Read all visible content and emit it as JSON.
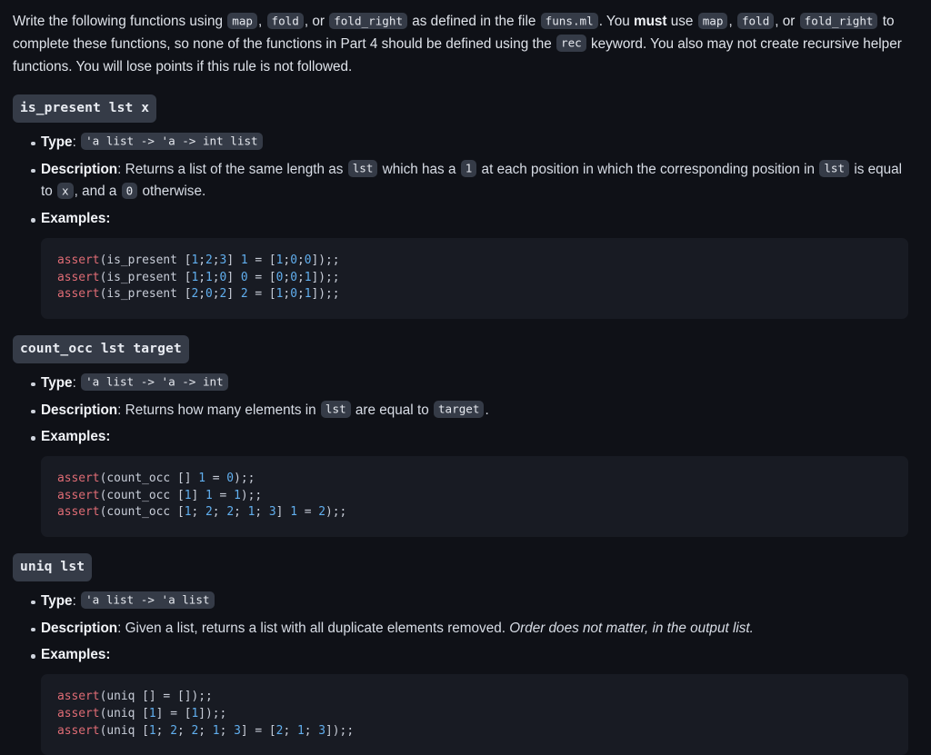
{
  "intro": {
    "segments": [
      {
        "t": "text",
        "v": "Write the following functions using "
      },
      {
        "t": "code",
        "v": "map"
      },
      {
        "t": "text",
        "v": ", "
      },
      {
        "t": "code",
        "v": "fold"
      },
      {
        "t": "text",
        "v": ", or "
      },
      {
        "t": "code",
        "v": "fold_right"
      },
      {
        "t": "text",
        "v": " as defined in the file "
      },
      {
        "t": "code",
        "v": "funs.ml"
      },
      {
        "t": "text",
        "v": ". You "
      },
      {
        "t": "bold",
        "v": "must"
      },
      {
        "t": "text",
        "v": " use "
      },
      {
        "t": "code",
        "v": "map"
      },
      {
        "t": "text",
        "v": ", "
      },
      {
        "t": "code",
        "v": "fold"
      },
      {
        "t": "text",
        "v": ", or "
      },
      {
        "t": "code",
        "v": "fold_right"
      },
      {
        "t": "text",
        "v": " to complete these functions, so none of the functions in Part 4 should be defined using the "
      },
      {
        "t": "code",
        "v": "rec"
      },
      {
        "t": "text",
        "v": " keyword. You also may not create recursive helper functions. You will lose points if this rule is not followed."
      }
    ]
  },
  "labels": {
    "type": "Type",
    "description": "Description",
    "examples": "Examples:"
  },
  "sections": [
    {
      "signature": "is_present lst x",
      "type": "'a list -> 'a -> int list",
      "description": [
        {
          "t": "lbl",
          "v": "Description"
        },
        {
          "t": "text",
          "v": ": Returns a list of the same length as "
        },
        {
          "t": "code",
          "v": "lst"
        },
        {
          "t": "text",
          "v": " which has a "
        },
        {
          "t": "code",
          "v": "1"
        },
        {
          "t": "text",
          "v": " at each position in which the corresponding position in "
        },
        {
          "t": "code",
          "v": "lst"
        },
        {
          "t": "text",
          "v": " is equal to "
        },
        {
          "t": "code",
          "v": "x"
        },
        {
          "t": "text",
          "v": ", and a "
        },
        {
          "t": "code",
          "v": "0"
        },
        {
          "t": "text",
          "v": " otherwise."
        }
      ],
      "code": [
        [
          {
            "c": "fn",
            "v": "assert"
          },
          {
            "c": "pl",
            "v": "(is_present ["
          },
          {
            "c": "num",
            "v": "1"
          },
          {
            "c": "pl",
            "v": ";"
          },
          {
            "c": "num",
            "v": "2"
          },
          {
            "c": "pl",
            "v": ";"
          },
          {
            "c": "num",
            "v": "3"
          },
          {
            "c": "pl",
            "v": "] "
          },
          {
            "c": "num",
            "v": "1"
          },
          {
            "c": "pl",
            "v": " = ["
          },
          {
            "c": "num",
            "v": "1"
          },
          {
            "c": "pl",
            "v": ";"
          },
          {
            "c": "num",
            "v": "0"
          },
          {
            "c": "pl",
            "v": ";"
          },
          {
            "c": "num",
            "v": "0"
          },
          {
            "c": "pl",
            "v": "]);;"
          }
        ],
        [
          {
            "c": "fn",
            "v": "assert"
          },
          {
            "c": "pl",
            "v": "(is_present ["
          },
          {
            "c": "num",
            "v": "1"
          },
          {
            "c": "pl",
            "v": ";"
          },
          {
            "c": "num",
            "v": "1"
          },
          {
            "c": "pl",
            "v": ";"
          },
          {
            "c": "num",
            "v": "0"
          },
          {
            "c": "pl",
            "v": "] "
          },
          {
            "c": "num",
            "v": "0"
          },
          {
            "c": "pl",
            "v": " = ["
          },
          {
            "c": "num",
            "v": "0"
          },
          {
            "c": "pl",
            "v": ";"
          },
          {
            "c": "num",
            "v": "0"
          },
          {
            "c": "pl",
            "v": ";"
          },
          {
            "c": "num",
            "v": "1"
          },
          {
            "c": "pl",
            "v": "]);;"
          }
        ],
        [
          {
            "c": "fn",
            "v": "assert"
          },
          {
            "c": "pl",
            "v": "(is_present ["
          },
          {
            "c": "num",
            "v": "2"
          },
          {
            "c": "pl",
            "v": ";"
          },
          {
            "c": "num",
            "v": "0"
          },
          {
            "c": "pl",
            "v": ";"
          },
          {
            "c": "num",
            "v": "2"
          },
          {
            "c": "pl",
            "v": "] "
          },
          {
            "c": "num",
            "v": "2"
          },
          {
            "c": "pl",
            "v": " = ["
          },
          {
            "c": "num",
            "v": "1"
          },
          {
            "c": "pl",
            "v": ";"
          },
          {
            "c": "num",
            "v": "0"
          },
          {
            "c": "pl",
            "v": ";"
          },
          {
            "c": "num",
            "v": "1"
          },
          {
            "c": "pl",
            "v": "]);;"
          }
        ]
      ]
    },
    {
      "signature": "count_occ lst target",
      "type": "'a list -> 'a -> int",
      "description": [
        {
          "t": "lbl",
          "v": "Description"
        },
        {
          "t": "text",
          "v": ": Returns how many elements in "
        },
        {
          "t": "code",
          "v": "lst"
        },
        {
          "t": "text",
          "v": " are equal to "
        },
        {
          "t": "code",
          "v": "target"
        },
        {
          "t": "text",
          "v": "."
        }
      ],
      "code": [
        [
          {
            "c": "fn",
            "v": "assert"
          },
          {
            "c": "pl",
            "v": "(count_occ [] "
          },
          {
            "c": "num",
            "v": "1"
          },
          {
            "c": "pl",
            "v": " = "
          },
          {
            "c": "num",
            "v": "0"
          },
          {
            "c": "pl",
            "v": ");;"
          }
        ],
        [
          {
            "c": "fn",
            "v": "assert"
          },
          {
            "c": "pl",
            "v": "(count_occ ["
          },
          {
            "c": "num",
            "v": "1"
          },
          {
            "c": "pl",
            "v": "] "
          },
          {
            "c": "num",
            "v": "1"
          },
          {
            "c": "pl",
            "v": " = "
          },
          {
            "c": "num",
            "v": "1"
          },
          {
            "c": "pl",
            "v": ");;"
          }
        ],
        [
          {
            "c": "fn",
            "v": "assert"
          },
          {
            "c": "pl",
            "v": "(count_occ ["
          },
          {
            "c": "num",
            "v": "1"
          },
          {
            "c": "pl",
            "v": "; "
          },
          {
            "c": "num",
            "v": "2"
          },
          {
            "c": "pl",
            "v": "; "
          },
          {
            "c": "num",
            "v": "2"
          },
          {
            "c": "pl",
            "v": "; "
          },
          {
            "c": "num",
            "v": "1"
          },
          {
            "c": "pl",
            "v": "; "
          },
          {
            "c": "num",
            "v": "3"
          },
          {
            "c": "pl",
            "v": "] "
          },
          {
            "c": "num",
            "v": "1"
          },
          {
            "c": "pl",
            "v": " = "
          },
          {
            "c": "num",
            "v": "2"
          },
          {
            "c": "pl",
            "v": ");;"
          }
        ]
      ]
    },
    {
      "signature": "uniq lst",
      "type": "'a list -> 'a list",
      "description": [
        {
          "t": "lbl",
          "v": "Description"
        },
        {
          "t": "text",
          "v": ": Given a list, returns a list with all duplicate elements removed. "
        },
        {
          "t": "italic",
          "v": "Order does not matter, in the output list."
        }
      ],
      "code": [
        [
          {
            "c": "fn",
            "v": "assert"
          },
          {
            "c": "pl",
            "v": "(uniq [] = []);;"
          }
        ],
        [
          {
            "c": "fn",
            "v": "assert"
          },
          {
            "c": "pl",
            "v": "(uniq ["
          },
          {
            "c": "num",
            "v": "1"
          },
          {
            "c": "pl",
            "v": "] = ["
          },
          {
            "c": "num",
            "v": "1"
          },
          {
            "c": "pl",
            "v": "]);;"
          }
        ],
        [
          {
            "c": "fn",
            "v": "assert"
          },
          {
            "c": "pl",
            "v": "(uniq ["
          },
          {
            "c": "num",
            "v": "1"
          },
          {
            "c": "pl",
            "v": "; "
          },
          {
            "c": "num",
            "v": "2"
          },
          {
            "c": "pl",
            "v": "; "
          },
          {
            "c": "num",
            "v": "2"
          },
          {
            "c": "pl",
            "v": "; "
          },
          {
            "c": "num",
            "v": "1"
          },
          {
            "c": "pl",
            "v": "; "
          },
          {
            "c": "num",
            "v": "3"
          },
          {
            "c": "pl",
            "v": "] = ["
          },
          {
            "c": "num",
            "v": "2"
          },
          {
            "c": "pl",
            "v": "; "
          },
          {
            "c": "num",
            "v": "1"
          },
          {
            "c": "pl",
            "v": "; "
          },
          {
            "c": "num",
            "v": "3"
          },
          {
            "c": "pl",
            "v": "]);;"
          }
        ]
      ]
    }
  ],
  "colors": {
    "page_bg": "#0f1117",
    "code_bg": "#181b23",
    "chip_bg": "#353b47",
    "text": "#d8dde6",
    "code_fn": "#e06c75",
    "code_num": "#61afef",
    "code_plain": "#c8cdd8"
  }
}
